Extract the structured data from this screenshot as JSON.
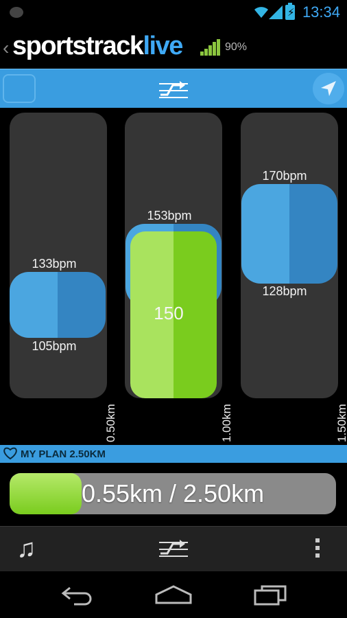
{
  "status": {
    "time": "13:34"
  },
  "header": {
    "logo_part1": "sportstrack",
    "logo_part2": "live",
    "signal_pct": "90%"
  },
  "columns": [
    {
      "upper_bpm": "133bpm",
      "lower_bpm": "105bpm",
      "km_label": "0.50km"
    },
    {
      "upper_bpm": "153bpm",
      "lower_bpm": "",
      "km_label": "1.00km",
      "current_value": "150"
    },
    {
      "upper_bpm": "170bpm",
      "lower_bpm": "128bpm",
      "km_label": "1.50km"
    }
  ],
  "plan": {
    "label": "MY PLAN 2.50KM"
  },
  "progress": {
    "text": "0.55km / 2.50km",
    "fraction": 0.22
  },
  "colors": {
    "accent": "#3a9de0",
    "green": "#7acc1e",
    "zone_blue": "#4ba6e0"
  },
  "icons": {
    "toolbar_left": "gauge-icon",
    "toolbar_center": "plan-icon",
    "toolbar_right": "navigation-icon",
    "action_left": "music-icon",
    "action_center": "plan-icon",
    "action_right": "overflow-menu-icon"
  }
}
